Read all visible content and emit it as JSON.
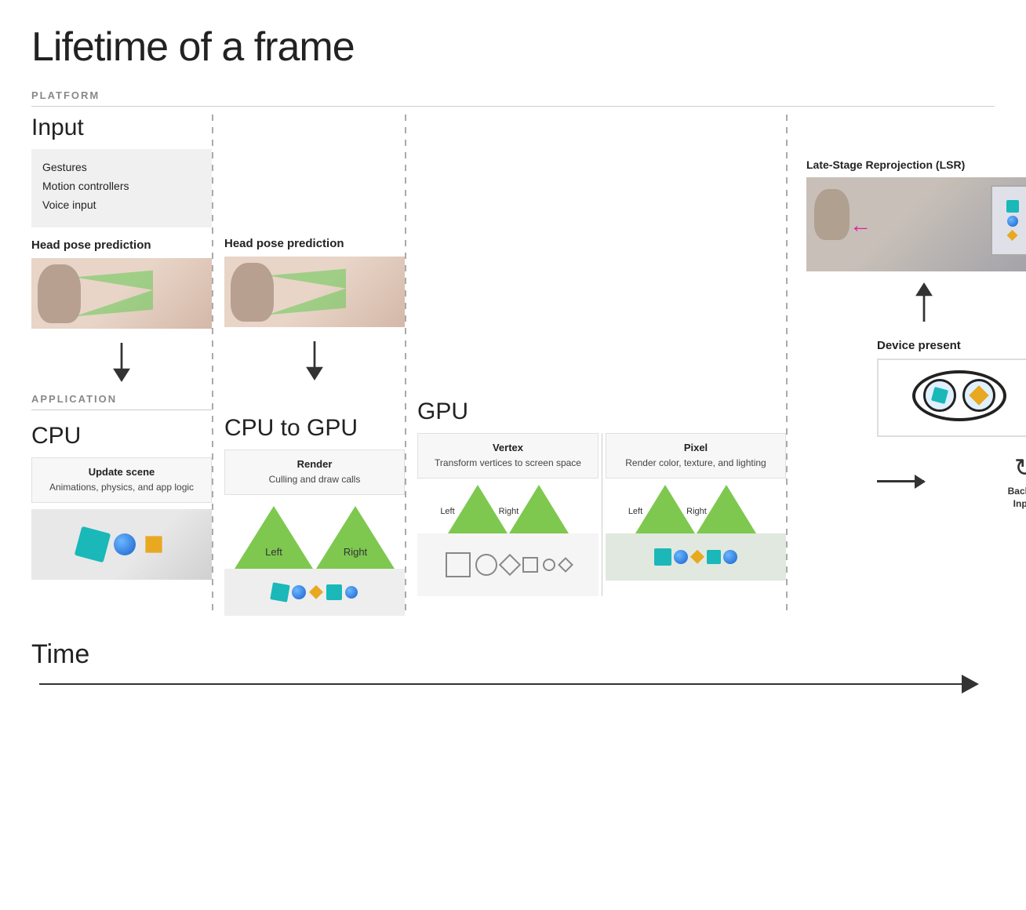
{
  "title": "Lifetime of a frame",
  "platform_label": "PLATFORM",
  "application_label": "APPLICATION",
  "time_label": "Time",
  "sections": {
    "input": {
      "label": "Input",
      "items": [
        "Gestures",
        "Motion controllers",
        "Voice input"
      ],
      "head_pose": "Head pose prediction"
    },
    "cpu": {
      "label": "CPU",
      "update_scene_title": "Update scene",
      "update_scene_desc": "Animations, physics, and app logic"
    },
    "cpu_to_gpu": {
      "label": "CPU to GPU",
      "head_pose": "Head pose prediction",
      "render_title": "Render",
      "render_desc": "Culling and draw calls",
      "left_label": "Left",
      "right_label": "Right"
    },
    "gpu": {
      "label": "GPU",
      "vertex": {
        "title": "Vertex",
        "desc": "Transform vertices to screen space",
        "left_label": "Left",
        "right_label": "Right"
      },
      "pixel": {
        "title": "Pixel",
        "desc": "Render color, texture, and lighting",
        "left_label": "Left",
        "right_label": "Right"
      }
    },
    "lsr": {
      "title": "Late-Stage Reprojection (LSR)"
    },
    "device_present": {
      "title": "Device present",
      "back_to_input": "Back to\nInput"
    }
  }
}
